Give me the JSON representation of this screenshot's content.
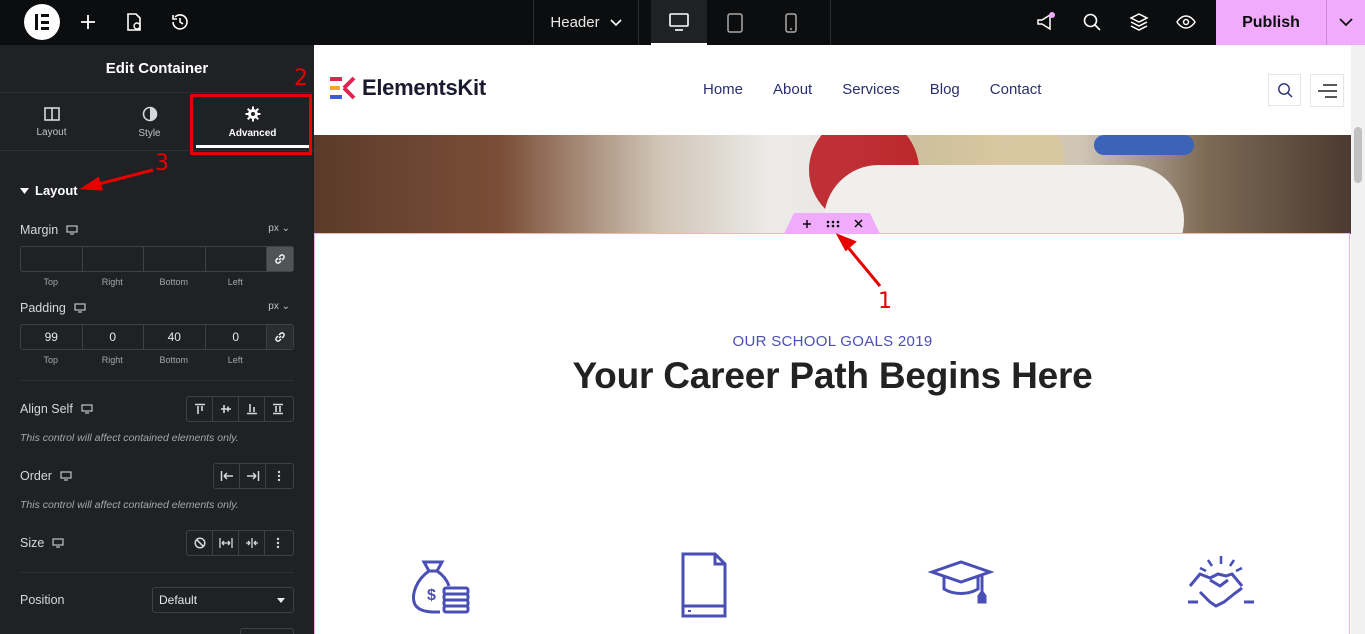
{
  "topbar": {
    "header_label": "Header",
    "publish_label": "Publish",
    "colors": {
      "bg": "#0c0d0e",
      "publish": "#f0abfc"
    }
  },
  "panel": {
    "title": "Edit Container",
    "tabs": [
      {
        "label": "Layout",
        "icon": "columns-icon"
      },
      {
        "label": "Style",
        "icon": "half-circle-icon"
      },
      {
        "label": "Advanced",
        "icon": "gear-icon",
        "active": true
      }
    ],
    "section_title": "Layout",
    "margin": {
      "label": "Margin",
      "unit": "px",
      "values": [
        "",
        "",
        "",
        ""
      ],
      "sides": [
        "Top",
        "Right",
        "Bottom",
        "Left"
      ]
    },
    "padding": {
      "label": "Padding",
      "unit": "px",
      "values": [
        "99",
        "0",
        "40",
        "0"
      ],
      "sides": [
        "Top",
        "Right",
        "Bottom",
        "Left"
      ]
    },
    "align_self": {
      "label": "Align Self",
      "note": "This control will affect contained elements only."
    },
    "order": {
      "label": "Order",
      "note": "This control will affect contained elements only."
    },
    "size": {
      "label": "Size"
    },
    "position": {
      "label": "Position",
      "value": "Default"
    }
  },
  "site": {
    "brand": "ElementsKit",
    "nav": [
      "Home",
      "About",
      "Services",
      "Blog",
      "Contact"
    ],
    "eyebrow": "OUR SCHOOL GOALS 2019",
    "headline": "Your Career Path Begins Here",
    "feature_icons": [
      "money-bag-icon",
      "document-icon",
      "graduation-cap-icon",
      "handshake-icon"
    ],
    "accent": "#4a4fb5"
  },
  "annotations": [
    "1",
    "2",
    "3"
  ]
}
